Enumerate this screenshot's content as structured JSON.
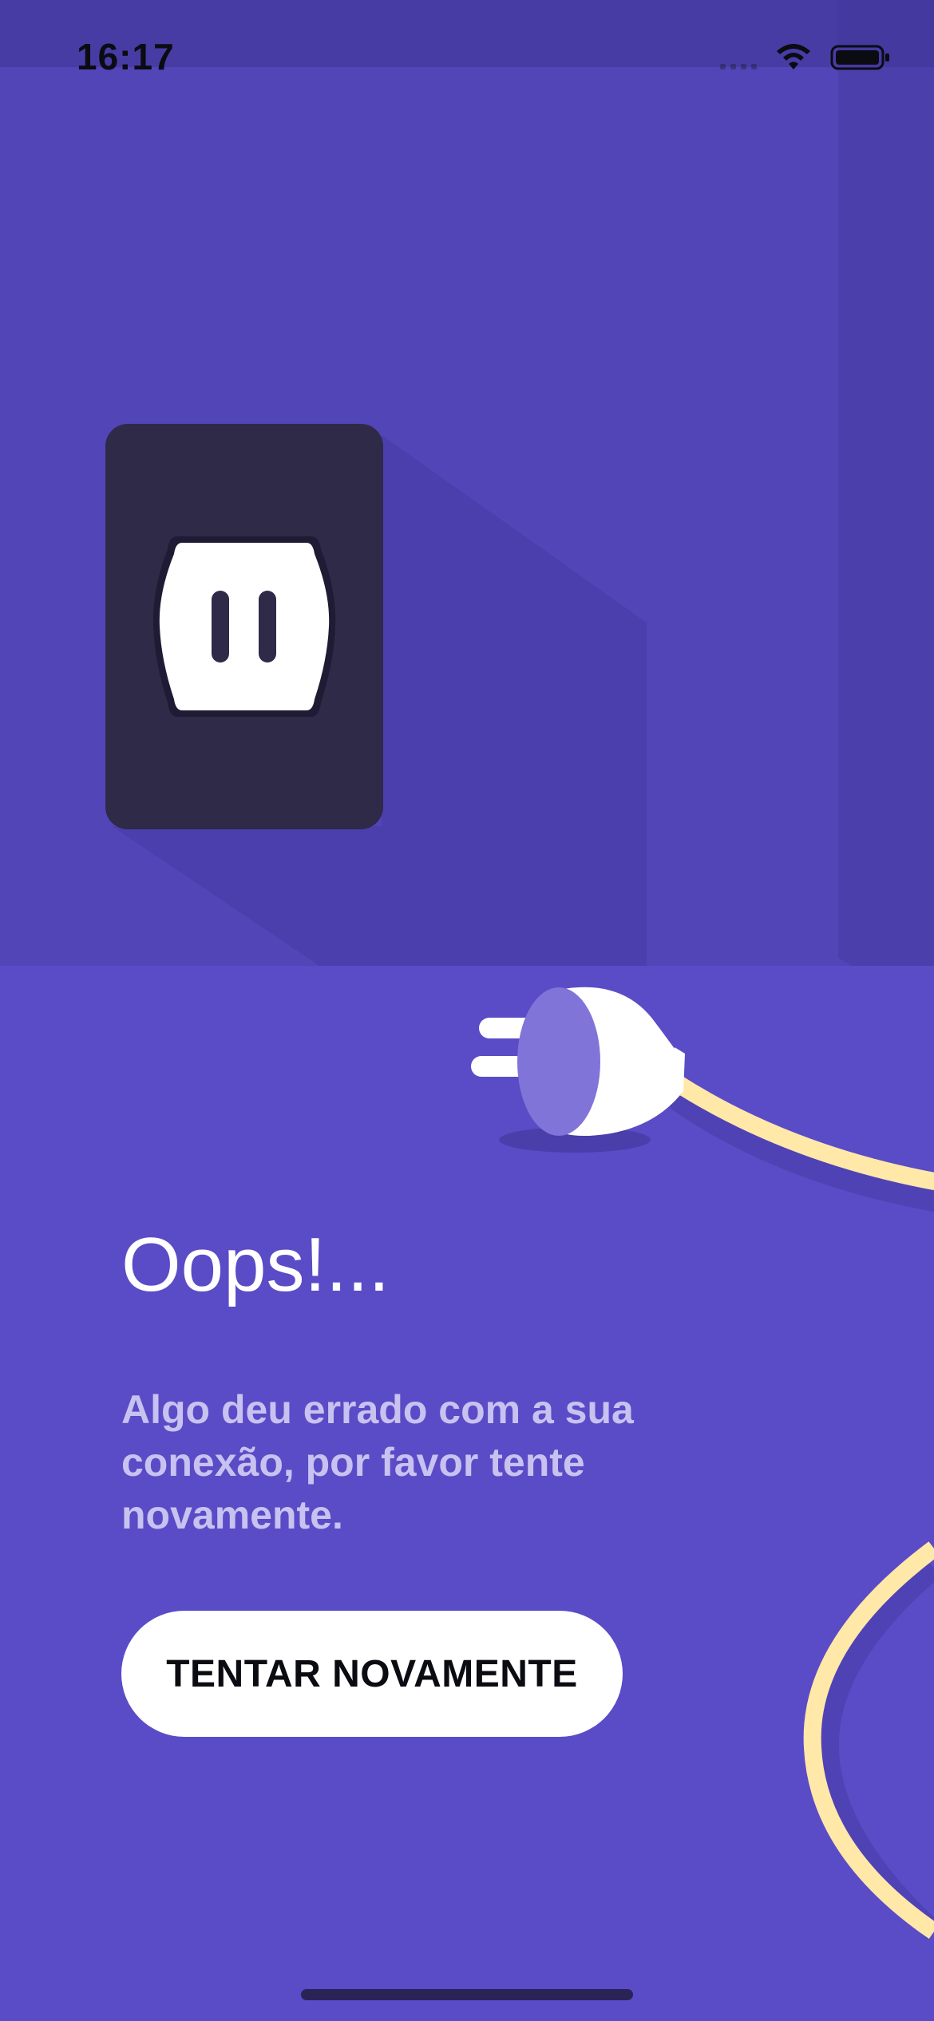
{
  "status_bar": {
    "time": "16:17",
    "icons": [
      "cellular-signal-icon",
      "wifi-icon",
      "battery-icon"
    ]
  },
  "error": {
    "title": "Oops!...",
    "message": "Algo deu errado com a sua conexão, por favor tente novamente.",
    "retry_label": "TENTAR NOVAMENTE"
  },
  "illustration": {
    "items": [
      "wall-outlet-icon",
      "plug-icon",
      "cable"
    ]
  },
  "colors": {
    "background": "#5a4bc7",
    "wall": "#5245b7",
    "outlet_plate": "#2f2a48",
    "cable": "#ffe8a8",
    "text_primary": "#ffffff",
    "text_secondary": "#c8c2f0",
    "button_bg": "#ffffff"
  }
}
